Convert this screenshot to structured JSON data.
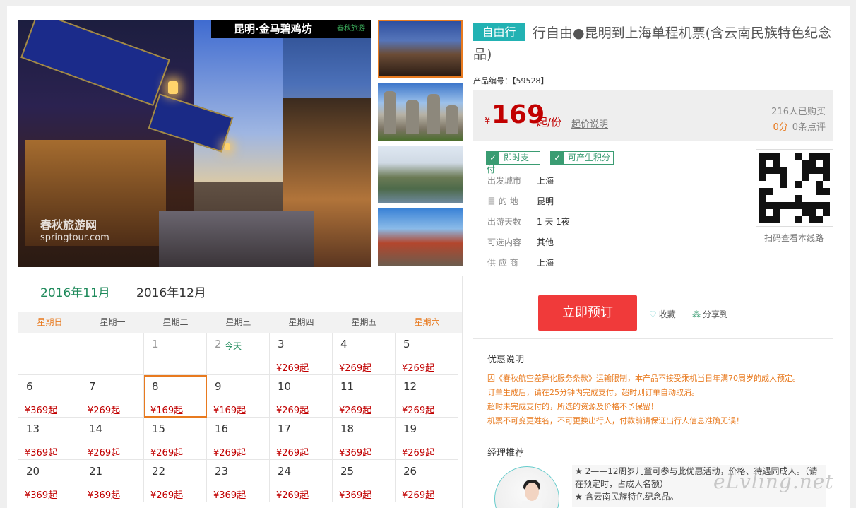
{
  "gallery": {
    "main_caption": "昆明·金马碧鸡坊",
    "main_brand": "春秋旅游",
    "watermark_cn": "春秋旅游网",
    "watermark_en": "springtour.com"
  },
  "calendar": {
    "tabs": [
      "2016年11月",
      "2016年12月"
    ],
    "weekdays": [
      "星期日",
      "星期一",
      "星期二",
      "星期三",
      "星期四",
      "星期五",
      "星期六"
    ],
    "today_label": "今天",
    "cells": [
      {
        "day": "",
        "price": ""
      },
      {
        "day": "",
        "price": ""
      },
      {
        "day": "1",
        "price": ""
      },
      {
        "day": "2",
        "price": ""
      },
      {
        "day": "3",
        "price": "¥269起"
      },
      {
        "day": "4",
        "price": "¥269起"
      },
      {
        "day": "5",
        "price": "¥269起"
      },
      {
        "day": "6",
        "price": "¥369起"
      },
      {
        "day": "7",
        "price": "¥269起"
      },
      {
        "day": "8",
        "price": "¥169起"
      },
      {
        "day": "9",
        "price": "¥169起"
      },
      {
        "day": "10",
        "price": "¥269起"
      },
      {
        "day": "11",
        "price": "¥269起"
      },
      {
        "day": "12",
        "price": "¥269起"
      },
      {
        "day": "13",
        "price": "¥369起"
      },
      {
        "day": "14",
        "price": "¥269起"
      },
      {
        "day": "15",
        "price": "¥269起"
      },
      {
        "day": "16",
        "price": "¥269起"
      },
      {
        "day": "17",
        "price": "¥269起"
      },
      {
        "day": "18",
        "price": "¥369起"
      },
      {
        "day": "19",
        "price": "¥269起"
      },
      {
        "day": "20",
        "price": "¥369起"
      },
      {
        "day": "21",
        "price": "¥369起"
      },
      {
        "day": "22",
        "price": "¥269起"
      },
      {
        "day": "23",
        "price": "¥369起"
      },
      {
        "day": "24",
        "price": "¥269起"
      },
      {
        "day": "25",
        "price": "¥369起"
      },
      {
        "day": "26",
        "price": "¥269起"
      }
    ]
  },
  "product": {
    "tag": "自由行",
    "title": "行自由●昆明到上海单程机票(含云南民族特色纪念品)",
    "code": "产品编号：【59528】",
    "currency": "¥",
    "price": "169",
    "price_unit": "起/份",
    "price_explain": "起价说明",
    "sold": "216人已购买",
    "score": "0分",
    "reviews": "0条点评"
  },
  "badges": [
    "即时支付",
    "可产生积分"
  ],
  "attributes": [
    {
      "key": "出发城市",
      "value": "上海"
    },
    {
      "key": "目 的 地",
      "value": "昆明"
    },
    {
      "key": "出游天数",
      "value": "1 天 1夜"
    },
    {
      "key": "可选内容",
      "value": "其他"
    },
    {
      "key": "供 应 商",
      "value": "上海"
    }
  ],
  "qr_caption": "扫码查看本线路",
  "actions": {
    "book": "立即预订",
    "favorite": "收藏",
    "share": "分享到"
  },
  "discount": {
    "title": "优惠说明",
    "lines": [
      "因《春秋航空差异化服务条款》运输限制，本产品不接受乘机当日年满70周岁的成人预定。",
      "订单生成后，请在25分钟内完成支付，超时则订单自动取消。",
      "超时未完成支付的，所选的资源及价格不予保留！",
      "机票不可变更姓名，不可更换出行人，付款前请保证出行人信息准确无误！"
    ]
  },
  "manager": {
    "title": "经理推荐",
    "lines": [
      "★ 2——12周岁儿童可参与此优惠活动，价格、待遇同成人。（请在预定时，占成人名额）",
      "★ 含云南民族特色纪念品。"
    ]
  },
  "site_watermark": "eLvling.net",
  "colors": {
    "accent_green": "#1f8a5b",
    "price_red": "#c10000",
    "orange": "#e87a1f",
    "book_red": "#f03a3a",
    "tag_teal": "#22b2b3"
  }
}
